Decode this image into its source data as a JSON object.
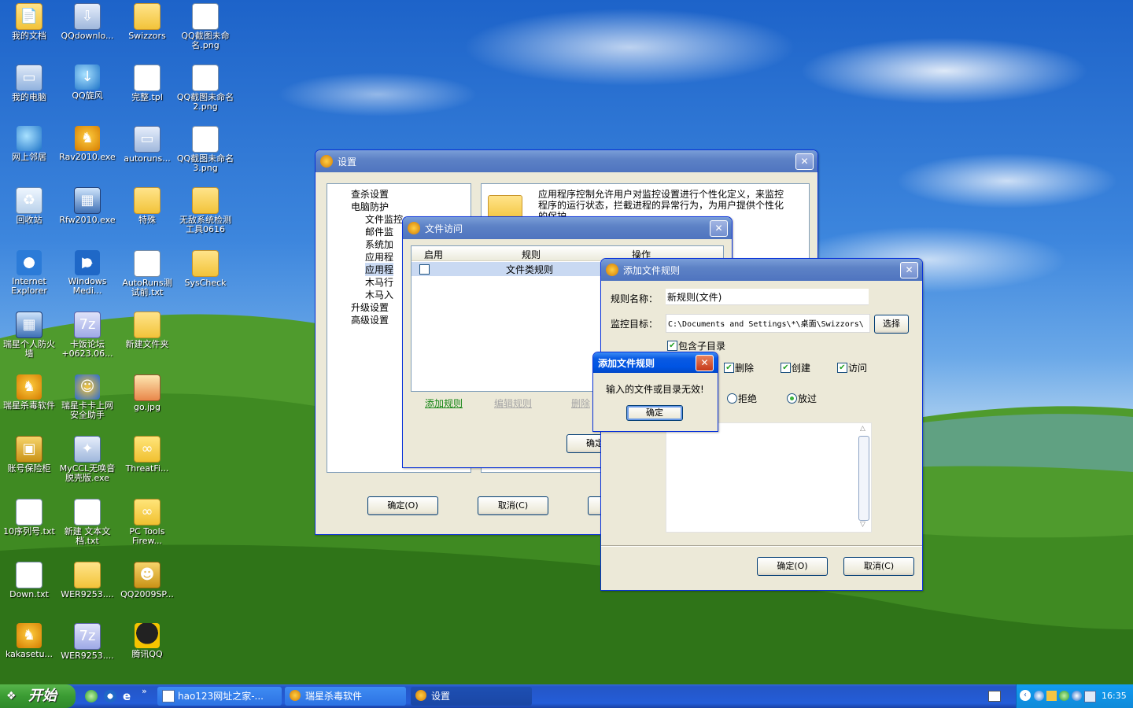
{
  "desktop_icons": [
    {
      "label": "我的文档",
      "icon": "my-documents-icon"
    },
    {
      "label": "QQdownlo...",
      "icon": "qq-download-folder-icon"
    },
    {
      "label": "Swizzors",
      "icon": "folder-icon"
    },
    {
      "label": "QQ截图未命名.png",
      "icon": "png-file-icon"
    },
    {
      "label": "我的电脑",
      "icon": "my-computer-icon"
    },
    {
      "label": "QQ旋风",
      "icon": "qq-whirlwind-icon"
    },
    {
      "label": "完整.tpl",
      "icon": "tpl-file-icon"
    },
    {
      "label": "QQ截图未命名2.png",
      "icon": "png-file-icon"
    },
    {
      "label": "网上邻居",
      "icon": "network-icon"
    },
    {
      "label": "Rav2010.exe",
      "icon": "rising-lion-icon"
    },
    {
      "label": "autoruns...",
      "icon": "autoruns-icon"
    },
    {
      "label": "QQ截图未命名3.png",
      "icon": "png-file-icon"
    },
    {
      "label": "回收站",
      "icon": "recycle-bin-icon"
    },
    {
      "label": "Rfw2010.exe",
      "icon": "firewall-icon"
    },
    {
      "label": "特殊",
      "icon": "folder-icon"
    },
    {
      "label": "无敌系统检测工具0616",
      "icon": "folder-icon"
    },
    {
      "label": "Internet Explorer",
      "icon": "internet-explorer-icon"
    },
    {
      "label": "Windows Medi...",
      "icon": "windows-media-player-icon"
    },
    {
      "label": "AutoRuns测试前.txt",
      "icon": "text-file-icon"
    },
    {
      "label": "SysCheck",
      "icon": "folder-icon"
    },
    {
      "label": "瑞星个人防火墙",
      "icon": "firewall-icon"
    },
    {
      "label": "卡饭论坛+0623.06...",
      "icon": "zip-file-icon"
    },
    {
      "label": "新建文件夹",
      "icon": "folder-icon"
    },
    {
      "label": "瑞星杀毒软件",
      "icon": "rising-lion-icon"
    },
    {
      "label": "瑞星卡卡上网安全助手",
      "icon": "kaka-assistant-icon"
    },
    {
      "label": "go.jpg",
      "icon": "image-file-icon"
    },
    {
      "label": "账号保险柜",
      "icon": "safe-icon"
    },
    {
      "label": "MyCCL无唤音脱壳版.exe",
      "icon": "exe-file-icon"
    },
    {
      "label": "ThreatFi...",
      "icon": "threatfire-icon"
    },
    {
      "label": "10序列号.txt",
      "icon": "text-file-icon"
    },
    {
      "label": "新建 文本文档.txt",
      "icon": "text-file-icon"
    },
    {
      "label": "PC Tools Firew...",
      "icon": "threatfire-icon"
    },
    {
      "label": "Down.txt",
      "icon": "text-file-icon"
    },
    {
      "label": "WER9253....",
      "icon": "folder-icon"
    },
    {
      "label": "QQ2009SP...",
      "icon": "qq-installer-icon"
    },
    {
      "label": "kakasetu...",
      "icon": "rising-lion-icon"
    },
    {
      "label": "WER9253....",
      "icon": "zip-file-icon"
    },
    {
      "label": "腾讯QQ",
      "icon": "qq-penguin-icon"
    }
  ],
  "settings_window": {
    "title": "设置",
    "tree": [
      {
        "label": "查杀设置"
      },
      {
        "label": "电脑防护"
      },
      {
        "label": "文件监控"
      },
      {
        "label": "邮件监"
      },
      {
        "label": "系统加"
      },
      {
        "label": "应用程"
      },
      {
        "label": "应用程"
      },
      {
        "label": "木马行"
      },
      {
        "label": "木马入"
      },
      {
        "label": "升级设置"
      },
      {
        "label": "高级设置"
      }
    ],
    "description": "应用程序控制允许用户对监控设置进行个性化定义，来监控程序的运行状态，拦截进程的异常行为，为用户提供个性化的保护。",
    "ok": "确定(O)",
    "cancel": "取消(C)"
  },
  "file_access_window": {
    "title": "文件访问",
    "columns": [
      "启用",
      "规则",
      "操作"
    ],
    "rows": [
      {
        "enabled": false,
        "rule": "文件类规则",
        "op": ""
      }
    ],
    "add_rule": "添加规则",
    "edit_rule": "编辑规则",
    "delete_rule": "删除",
    "ok": "确定"
  },
  "add_rule_window": {
    "title": "添加文件规则",
    "rule_name_label": "规则名称：",
    "rule_name_value": "新规则(文件)",
    "target_label": "监控目标：",
    "target_value": "C:\\Documents and Settings\\*\\桌面\\Swizzors\\",
    "select_button": "选择",
    "include_subdirs": "包含子目录",
    "ops": [
      {
        "label": "删除",
        "checked": true
      },
      {
        "label": "创建",
        "checked": true
      },
      {
        "label": "访问",
        "checked": true
      }
    ],
    "actions": [
      {
        "label": "拒绝",
        "selected": false
      },
      {
        "label": "放过",
        "selected": true
      }
    ],
    "ok": "确定(O)",
    "cancel": "取消(C)"
  },
  "alert_dialog": {
    "title": "添加文件规则",
    "message": "输入的文件或目录无效!",
    "ok": "确定"
  },
  "taskbar": {
    "start_label": "开始",
    "tasks": [
      {
        "label": "hao123网址之家-..."
      },
      {
        "label": "瑞星杀毒软件"
      },
      {
        "label": "设置"
      }
    ],
    "clock": "16:35"
  }
}
